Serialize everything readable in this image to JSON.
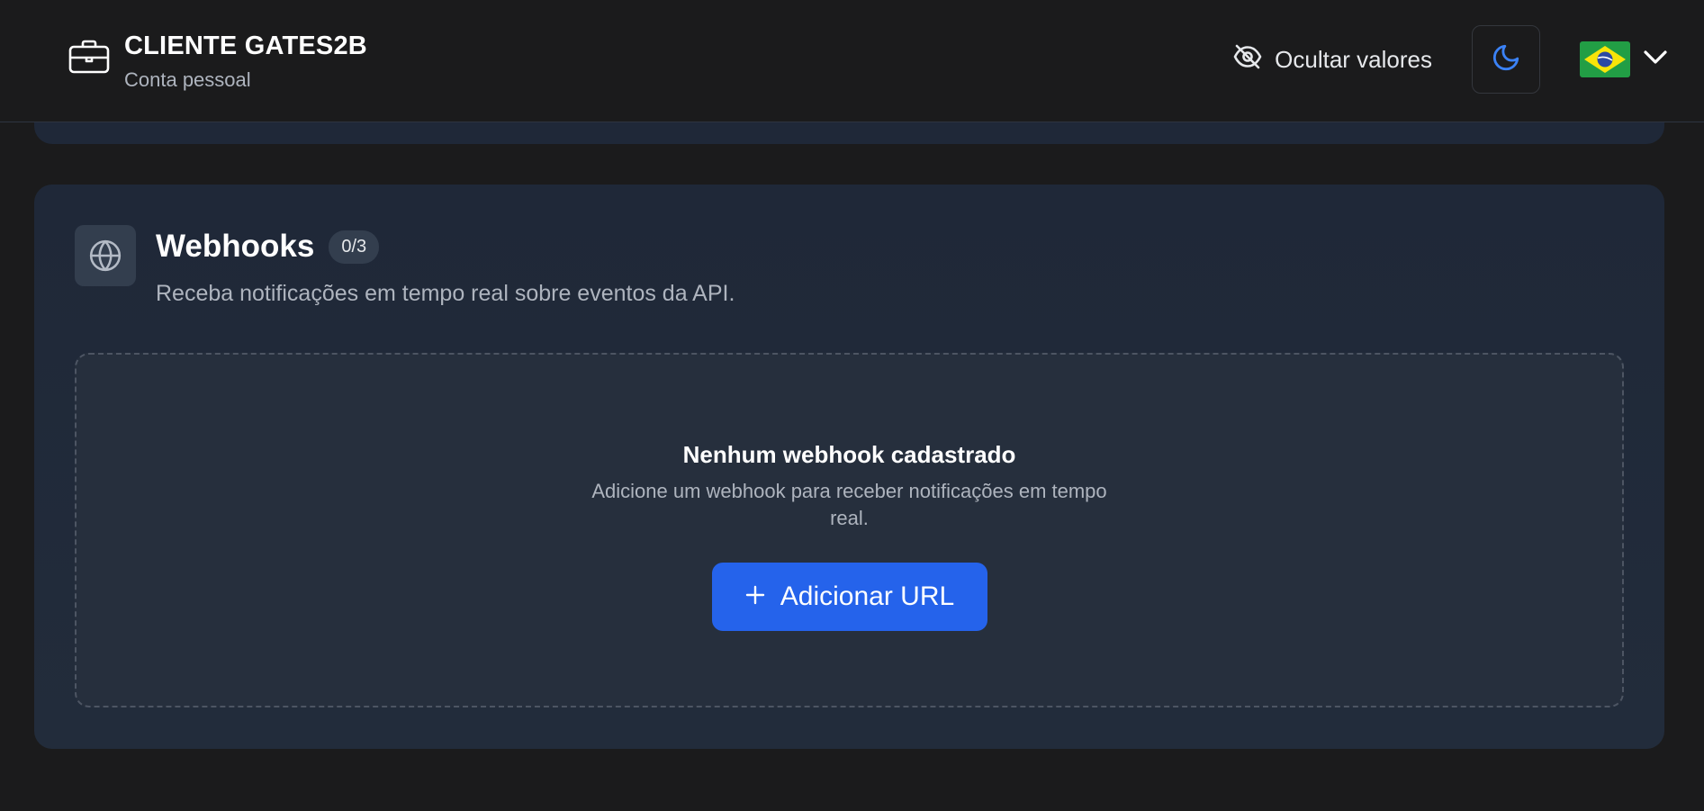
{
  "header": {
    "brand_title": "CLIENTE GATES2B",
    "brand_subtitle": "Conta pessoal",
    "brand_icon": "briefcase-icon",
    "hide_values_label": "Ocultar valores",
    "hide_values_icon": "eye-off-icon",
    "theme_icon": "moon-icon",
    "language_icon": "brazil-flag-icon",
    "language_chevron_icon": "chevron-down-icon"
  },
  "webhooks": {
    "icon": "globe-icon",
    "title": "Webhooks",
    "count": "0/3",
    "description": "Receba notificações em tempo real sobre eventos da API.",
    "empty_title": "Nenhum webhook cadastrado",
    "empty_description": "Adicione um webhook para receber notificações em tempo real.",
    "add_button_icon": "plus-icon",
    "add_button_label": "Adicionar URL"
  },
  "colors": {
    "background": "#1b1b1c",
    "card": "#1f2838",
    "empty_box": "#262f3d",
    "accent": "#2563eb",
    "moon": "#3b82f6",
    "muted_text": "#aeb4be"
  }
}
